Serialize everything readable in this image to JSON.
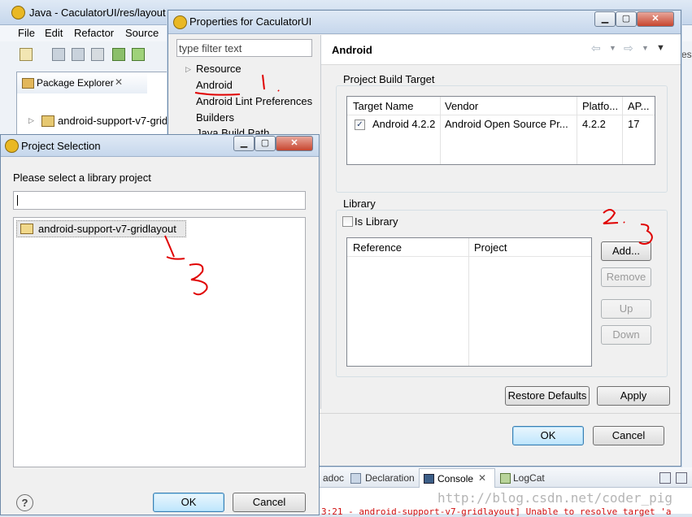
{
  "eclipse": {
    "title": "Java - CaculatorUI/res/layout",
    "menu": [
      "File",
      "Edit",
      "Refactor",
      "Source"
    ],
    "package_explorer": "Package Explorer",
    "project_item": "android-support-v7-gridl",
    "bottom_tabs": [
      "adoc",
      "Declaration",
      "Console",
      "LogCat"
    ],
    "console_text": "3:21 - android-support-v7-gridlayout] Unable to resolve target 'a",
    "watermark": "http://blog.csdn.net/coder_pig",
    "right_edge_text": "ess"
  },
  "properties": {
    "title": "Properties for CaculatorUI",
    "filter_placeholder": "type filter text",
    "tree": [
      "Resource",
      "Android",
      "Android Lint Preferences",
      "Builders",
      "Java Build Path"
    ],
    "header": "Android",
    "build_target": {
      "label": "Project Build Target",
      "columns": [
        "Target Name",
        "Vendor",
        "Platfo...",
        "AP..."
      ],
      "rows": [
        {
          "checked": true,
          "name": "Android 4.2.2",
          "vendor": "Android Open Source Pr...",
          "platform": "4.2.2",
          "api": "17"
        }
      ]
    },
    "library": {
      "label": "Library",
      "is_library": "Is Library",
      "columns": [
        "Reference",
        "Project"
      ],
      "buttons": [
        "Add...",
        "Remove",
        "Up",
        "Down"
      ]
    },
    "restore_defaults": "Restore Defaults",
    "apply": "Apply",
    "ok": "OK",
    "cancel": "Cancel"
  },
  "project_selection": {
    "title": "Project Selection",
    "prompt": "Please select a library project",
    "search_value": "",
    "items": [
      "android-support-v7-gridlayout"
    ],
    "ok": "OK",
    "cancel": "Cancel",
    "help": "?"
  },
  "annotations": {
    "step1": "1",
    "step2": "2.",
    "step3": "3"
  }
}
